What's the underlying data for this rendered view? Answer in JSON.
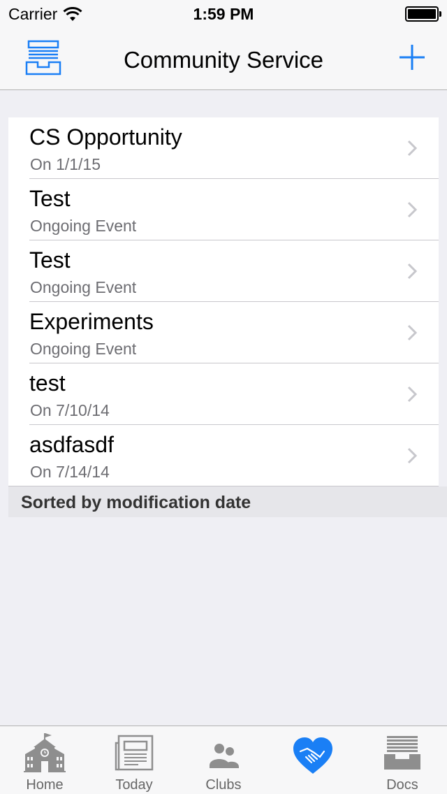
{
  "status_bar": {
    "carrier": "Carrier",
    "time": "1:59 PM"
  },
  "nav": {
    "title": "Community Service",
    "left_icon": "inbox-tray-icon",
    "right_icon": "plus-icon"
  },
  "list": {
    "items": [
      {
        "title": "CS Opportunity",
        "subtitle": "On 1/1/15"
      },
      {
        "title": "Test",
        "subtitle": "Ongoing Event"
      },
      {
        "title": "Test",
        "subtitle": "Ongoing Event"
      },
      {
        "title": "Experiments",
        "subtitle": "Ongoing Event"
      },
      {
        "title": "test",
        "subtitle": "On 7/10/14"
      },
      {
        "title": "asdfasdf",
        "subtitle": "On 7/14/14"
      }
    ],
    "footer": "Sorted by modification date"
  },
  "tabs": [
    {
      "label": "Home",
      "icon": "school-building-icon"
    },
    {
      "label": "Today",
      "icon": "newspaper-icon"
    },
    {
      "label": "Clubs",
      "icon": "people-icon"
    },
    {
      "label": "",
      "icon": "heart-handshake-icon",
      "selected": true
    },
    {
      "label": "Docs",
      "icon": "document-tray-icon"
    }
  ],
  "colors": {
    "accent": "#1a7ff5",
    "tab_inactive": "#8e8e8e",
    "background": "#efeff4"
  }
}
